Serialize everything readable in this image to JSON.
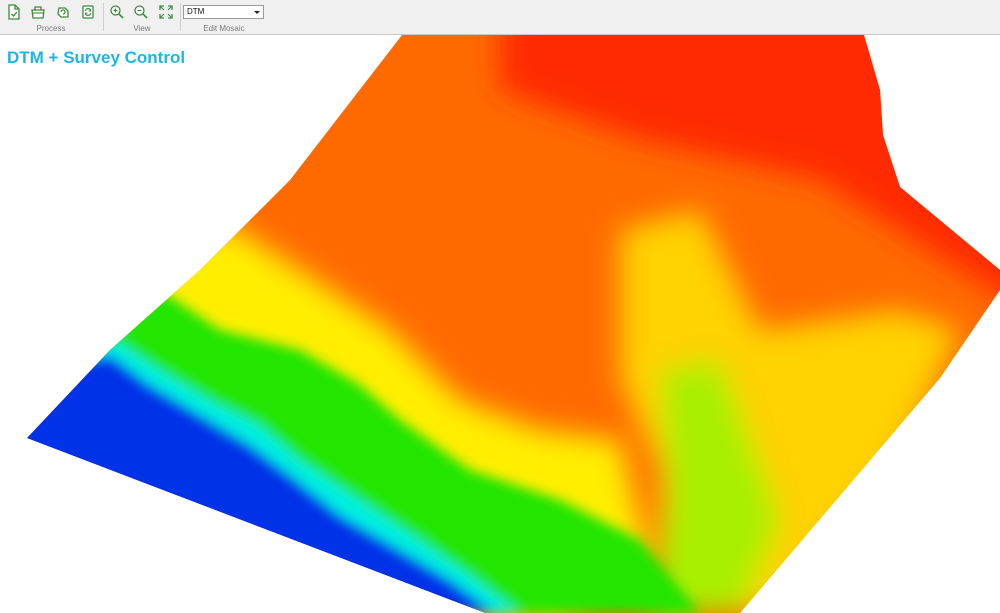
{
  "toolbar": {
    "groups": {
      "process": "Process",
      "view": "View",
      "edit_mosaic": "Edit Mosaic"
    },
    "mosaic_select": {
      "value": "DTM"
    },
    "icons": {
      "process": [
        "new-document-icon",
        "open-project-icon",
        "reload-icon",
        "refresh-icon"
      ],
      "view": [
        "zoom-in-icon",
        "zoom-out-icon",
        "fit-extent-icon"
      ]
    },
    "icon_color": "#3d8b3d"
  },
  "map": {
    "title": "DTM + Survey Control",
    "title_color": "#1fb4e8",
    "colormap": [
      "#0026e6",
      "#00e5ff",
      "#00e600",
      "#ffff00",
      "#ff8c00",
      "#ff1a00"
    ]
  }
}
